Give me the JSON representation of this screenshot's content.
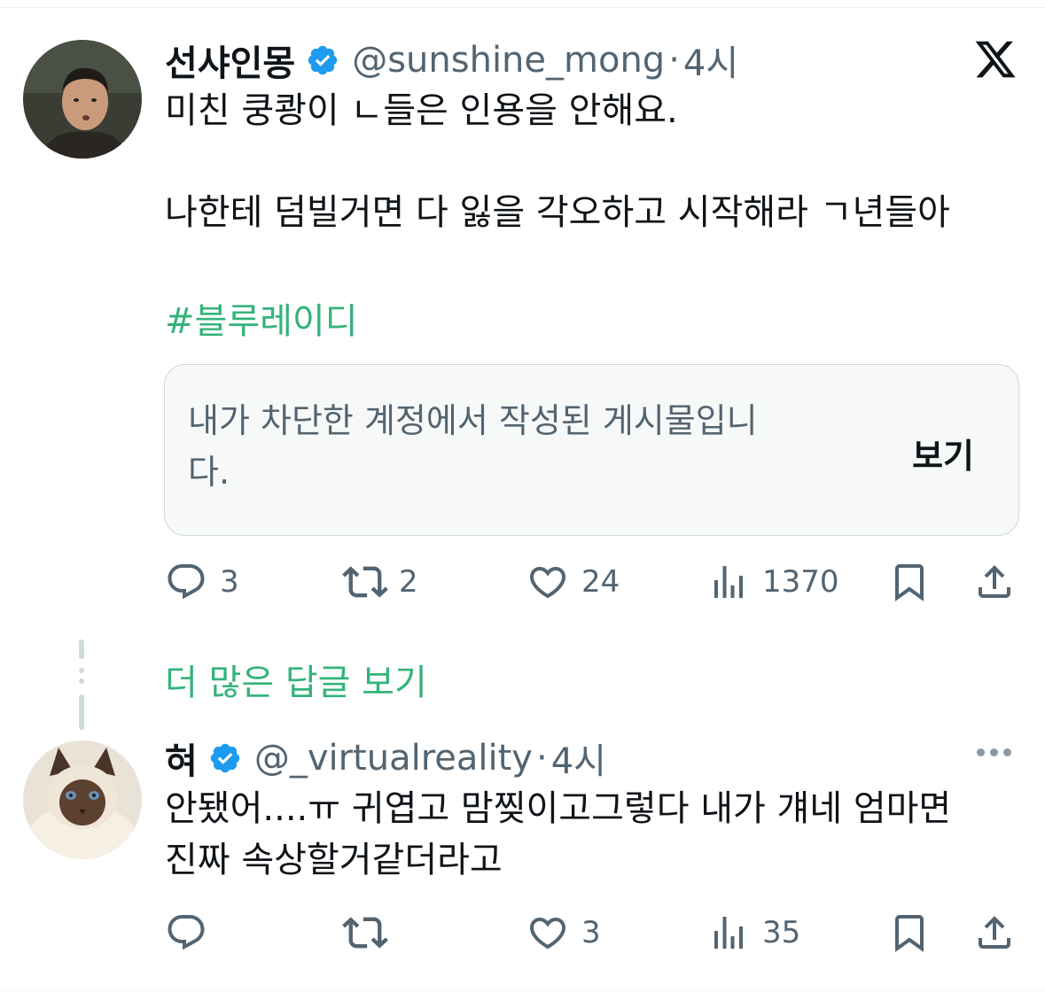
{
  "tweet": {
    "display_name": "선샤인몽",
    "handle": "@sunshine_mong",
    "separator": "·",
    "time": "4시",
    "text_line1": "미친 쿵쾅이 ㄴ들은 인용을 안해요.",
    "text_line2": "나한테 덤빌거면 다 잃을 각오하고 시작해라 ㄱ년들아",
    "hashtag": "#블루레이디",
    "quote": {
      "message_line1": "내가 차단한 계정에서 작성된 게시물입니",
      "message_line2": "다.",
      "view_label": "보기"
    },
    "replies": "3",
    "reposts": "2",
    "likes": "24",
    "views": "1370"
  },
  "more_replies_label": "더 많은 답글 보기",
  "reply": {
    "display_name": "혀",
    "handle": "@_virtualreality",
    "separator": "·",
    "time": "4시",
    "text_line1": "안됐어....ㅠ 귀엽고 맘찢이고그렇다 내가 걔네 엄마면",
    "text_line2": "진짜 속상할거같더라고",
    "replies": "",
    "reposts": "",
    "likes": "3",
    "views": "35"
  },
  "colors": {
    "verified": "#1d9bf0",
    "accent_green": "#34b37a",
    "secondary_text": "#536471",
    "border": "#cfd9de"
  },
  "icons": [
    "x-logo-icon",
    "verified-badge-icon",
    "reply-icon",
    "repost-icon",
    "like-icon",
    "views-icon",
    "bookmark-icon",
    "share-icon",
    "more-icon"
  ]
}
